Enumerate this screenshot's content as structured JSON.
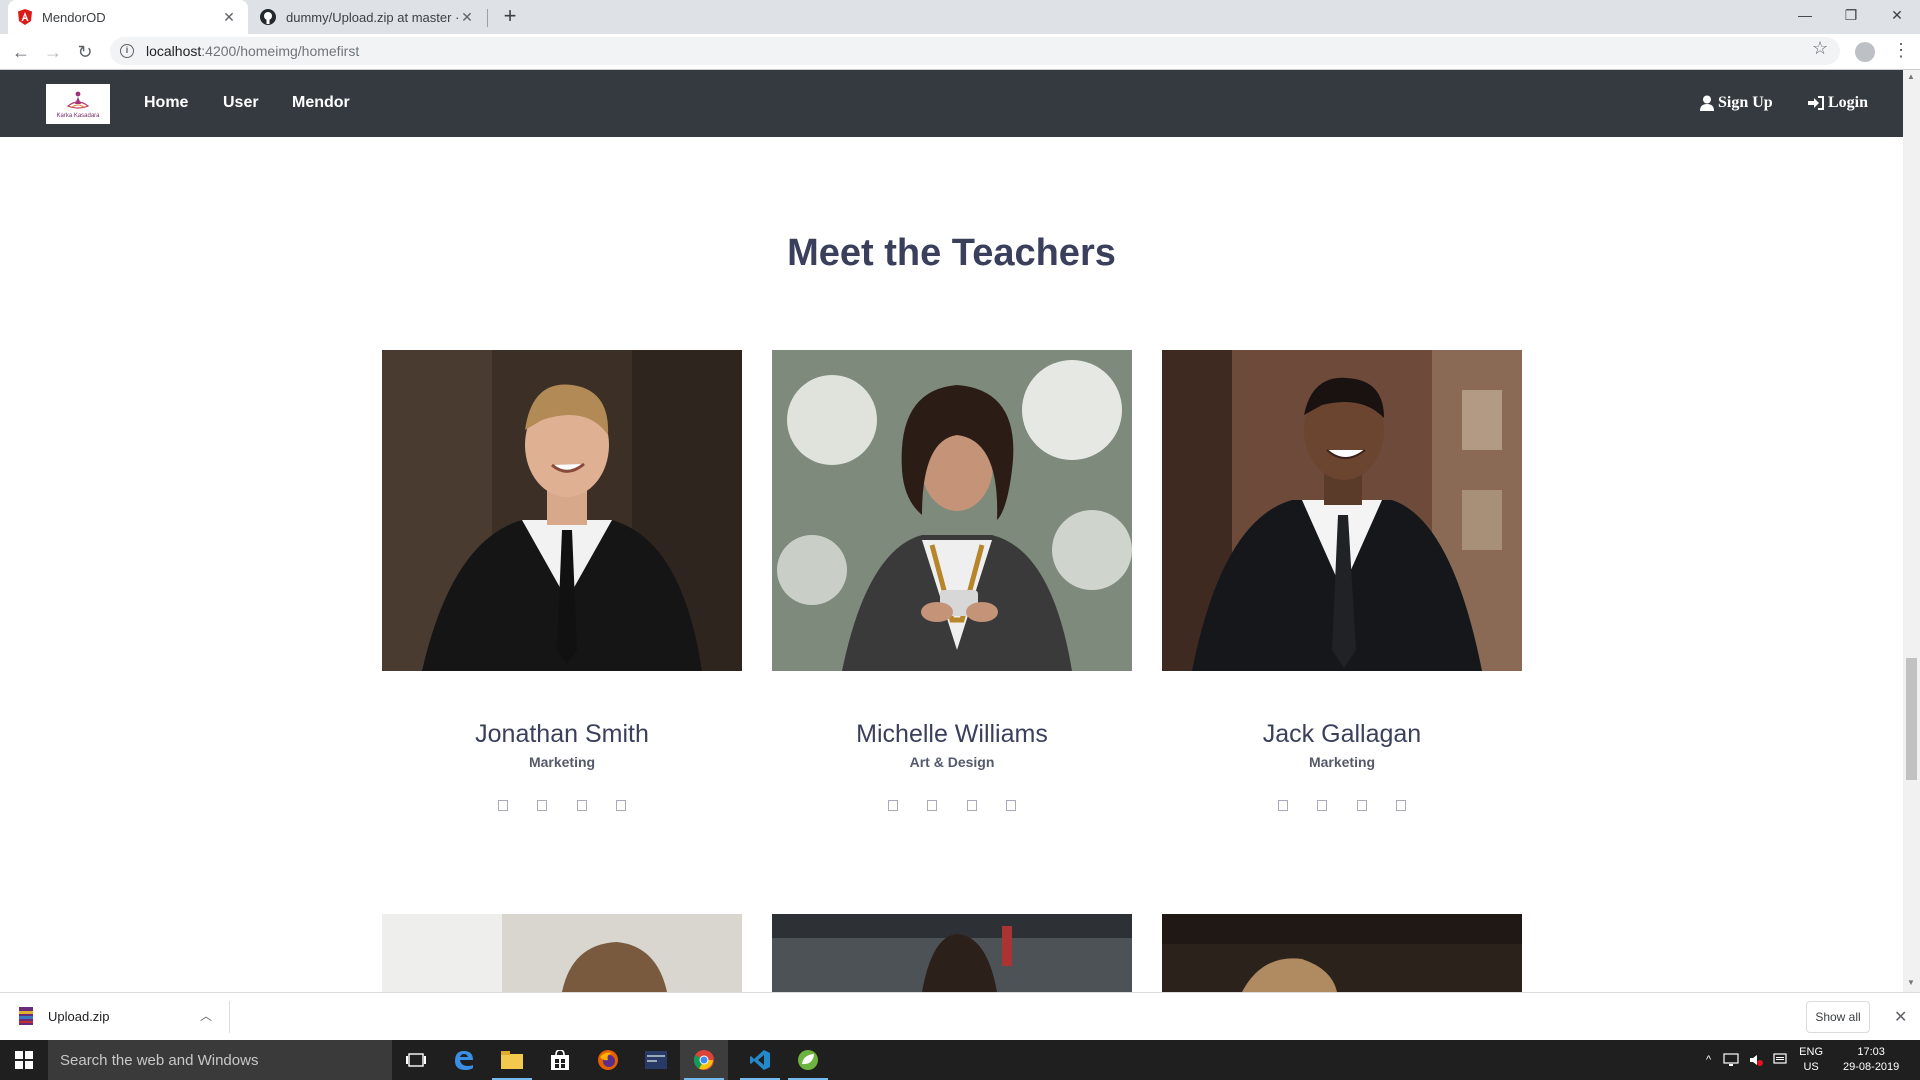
{
  "browser": {
    "tabs": [
      {
        "title": "MendorOD",
        "icon": "angular-icon"
      },
      {
        "title": "dummy/Upload.zip at master · th",
        "icon": "github-icon"
      }
    ],
    "url_host": "localhost",
    "url_path": ":4200/homeimg/homefirst"
  },
  "navbar": {
    "logo_text": "Karka Kasadara",
    "links": [
      "Home",
      "User",
      "Mendor"
    ],
    "signup": "Sign Up",
    "login": "Login"
  },
  "main": {
    "title": "Meet the Teachers",
    "teachers": [
      {
        "name": "Jonathan Smith",
        "subject": "Marketing"
      },
      {
        "name": "Michelle Williams",
        "subject": "Art & Design"
      },
      {
        "name": "Jack Gallagan",
        "subject": "Marketing"
      }
    ]
  },
  "downloads": {
    "file": "Upload.zip",
    "show_all": "Show all"
  },
  "taskbar": {
    "search_placeholder": "Search the web and Windows",
    "lang_top": "ENG",
    "lang_bottom": "US",
    "time": "17:03",
    "date": "29-08-2019"
  },
  "colors": {
    "navbar_bg": "#343a40",
    "title_color": "#3a3f5c"
  }
}
